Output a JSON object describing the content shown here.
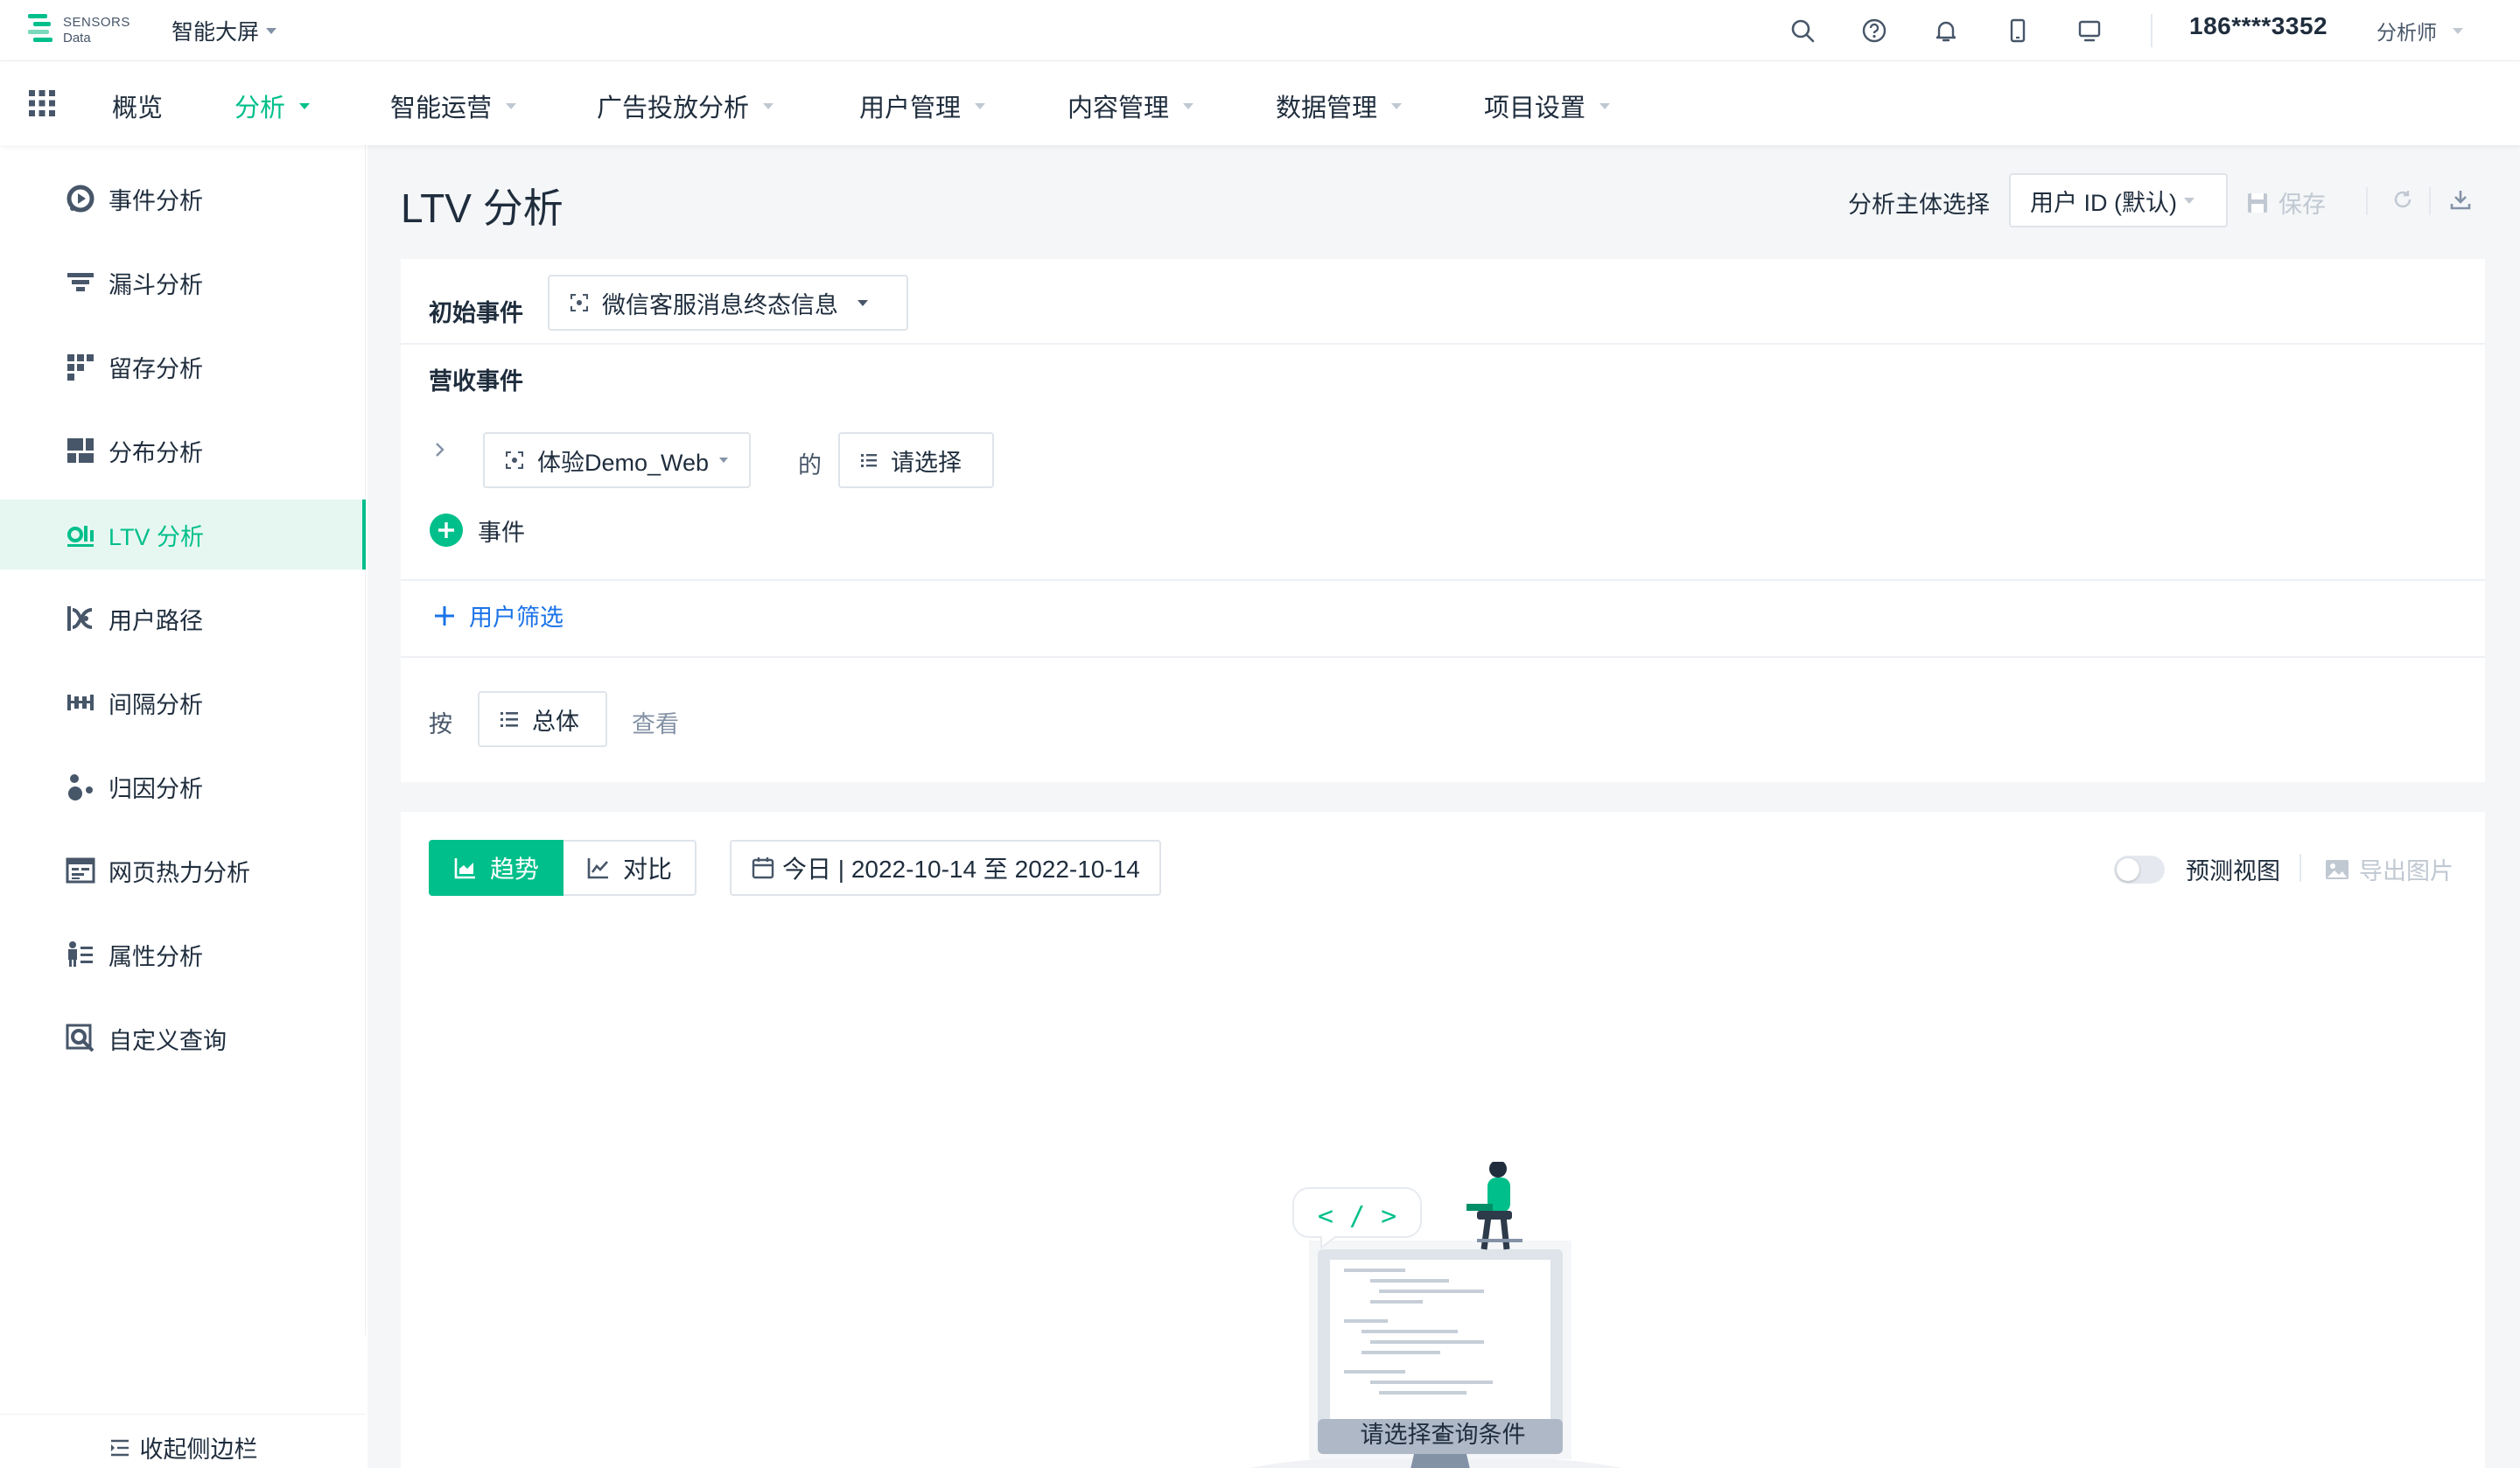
{
  "topbar": {
    "logo_line1": "SENSORS",
    "logo_line2": "Data",
    "screen_menu": "智能大屏",
    "icons": [
      "search-icon",
      "help-icon",
      "bell-icon",
      "mobile-icon",
      "monitor-icon"
    ],
    "user_phone": "186****3352",
    "user_role": "分析师"
  },
  "nav": {
    "items": [
      {
        "label": "概览"
      },
      {
        "label": "分析"
      },
      {
        "label": "智能运营"
      },
      {
        "label": "广告投放分析"
      },
      {
        "label": "用户管理"
      },
      {
        "label": "内容管理"
      },
      {
        "label": "数据管理"
      },
      {
        "label": "项目设置"
      }
    ],
    "active": "分析"
  },
  "sidebar": {
    "items": [
      {
        "label": "事件分析",
        "icon": "event-analysis-icon"
      },
      {
        "label": "漏斗分析",
        "icon": "funnel-icon"
      },
      {
        "label": "留存分析",
        "icon": "retention-icon"
      },
      {
        "label": "分布分析",
        "icon": "distribution-icon"
      },
      {
        "label": "LTV 分析",
        "icon": "ltv-icon"
      },
      {
        "label": "用户路径",
        "icon": "user-path-icon"
      },
      {
        "label": "间隔分析",
        "icon": "interval-icon"
      },
      {
        "label": "归因分析",
        "icon": "attribution-icon"
      },
      {
        "label": "网页热力分析",
        "icon": "heatmap-icon"
      },
      {
        "label": "属性分析",
        "icon": "attribute-icon"
      },
      {
        "label": "自定义查询",
        "icon": "custom-query-icon"
      }
    ],
    "active": "LTV 分析",
    "collapse_label": "收起侧边栏"
  },
  "page": {
    "title": "LTV 分析",
    "subject_label": "分析主体选择",
    "subject_value": "用户 ID (默认)",
    "save_label": "保存"
  },
  "query": {
    "initial_event_label": "初始事件",
    "initial_event_value": "微信客服消息终态信息",
    "revenue_event_label": "营收事件",
    "revenue_event_value": "体验Demo_Web",
    "of_label": "的",
    "property_placeholder": "请选择",
    "add_event_label": "事件",
    "user_filter_label": "用户筛选",
    "group_prefix": "按",
    "group_value": "总体",
    "group_suffix": "查看"
  },
  "result": {
    "tabs": [
      "趋势",
      "对比"
    ],
    "active_tab": "趋势",
    "date_range": "今日 | 2022-10-14 至 2022-10-14",
    "predict_label": "预测视图",
    "predict_enabled": false,
    "export_label": "导出图片",
    "illustration_code": "< / >",
    "empty_text": "请选择查询条件"
  },
  "colors": {
    "accent": "#00bf8a",
    "link": "#1b73e8",
    "text": "#1f2d3d",
    "muted": "#c0c8d2"
  }
}
